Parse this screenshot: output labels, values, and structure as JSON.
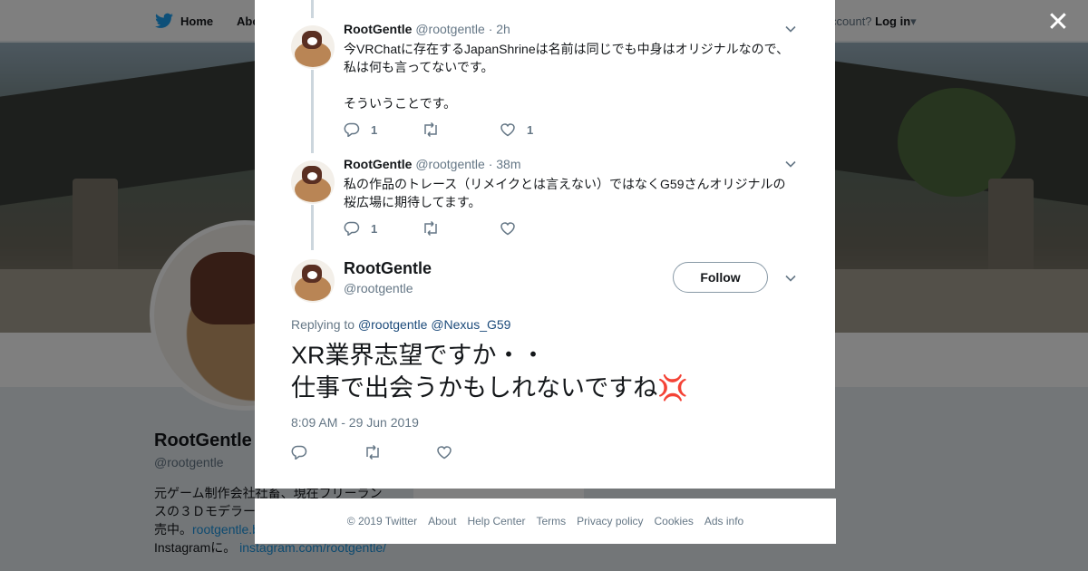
{
  "background": {
    "nav": {
      "home": "Home",
      "about": "Abo",
      "login_prompt": "ccount?",
      "login": "Log in"
    },
    "profile": {
      "name": "RootGentle",
      "handle": "@rootgentle",
      "bio_line1": "元ゲーム制作会社社畜、現在フリーラン",
      "bio_line2": "スの３Ｄモデラー",
      "bio_line3_text": "売中。",
      "bio_link1": "rootgentle.b",
      "bio_line4_text": "Instagramに。",
      "bio_link2": "instagram.com/rootgentle/"
    },
    "ads_stub": "Ads info"
  },
  "close_label": "✕",
  "thread": [
    {
      "name": "RootGentle",
      "handle": "@rootgentle",
      "time": "· 2h",
      "text_line1": "今VRChatに存在するJapanShrineは名前は同じでも中身はオリジナルなので、",
      "text_line2": "私は何も言ってないです。",
      "text_line3": "",
      "text_line4": "そういうことです。",
      "replies": "1",
      "retweets": "",
      "likes": "1"
    },
    {
      "name": "RootGentle",
      "handle": "@rootgentle",
      "time": "· 38m",
      "text_line1": "私の作品のトレース（リメイクとは言えない）ではなくG59さんオリジナルの",
      "text_line2": "桜広場に期待してます。",
      "replies": "1",
      "retweets": "",
      "likes": ""
    }
  ],
  "main_tweet": {
    "name": "RootGentle",
    "handle": "@rootgentle",
    "follow_label": "Follow",
    "replying_label": "Replying to",
    "mention1": "@rootgentle",
    "mention2": "@Nexus_G59",
    "text_line1": "XR業界志望ですか・・",
    "text_line2": "仕事で出会うかもしれないですね",
    "emoji": "💢",
    "timestamp": "8:09 AM - 29 Jun 2019"
  },
  "footer": {
    "copyright": "© 2019 Twitter",
    "links": [
      "About",
      "Help Center",
      "Terms",
      "Privacy policy",
      "Cookies",
      "Ads info"
    ]
  },
  "colors": {
    "accent": "#1da1f2",
    "text": "#14171a",
    "muted": "#657786",
    "thread_line": "#ccd6dd",
    "anger_emoji": "#e0245e"
  },
  "icons": [
    "twitter-bird-icon",
    "close-icon",
    "chevron-down-icon",
    "reply-icon",
    "retweet-icon",
    "like-icon"
  ]
}
